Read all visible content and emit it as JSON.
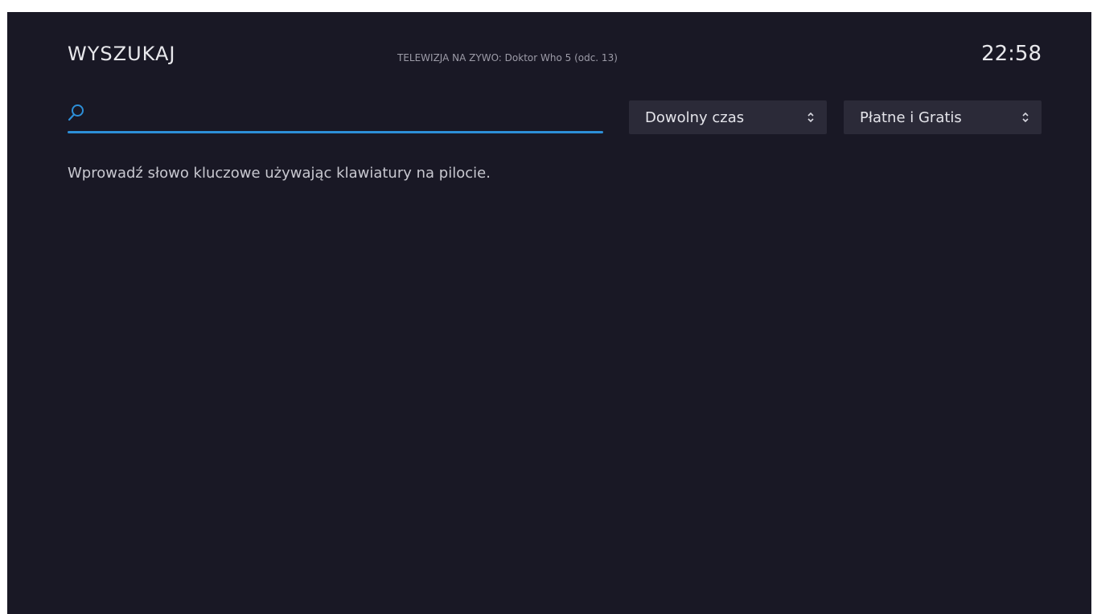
{
  "header": {
    "title": "WYSZUKAJ",
    "now_playing": "TELEWIZJA NA ZYWO: Doktor Who 5 (odc. 13)",
    "clock": "22:58"
  },
  "search": {
    "value": "",
    "placeholder": "",
    "icon": "search-icon",
    "accent_color": "#2d8fd8"
  },
  "filters": {
    "time": {
      "selected": "Dowolny czas",
      "icon": "up-down-arrows-icon"
    },
    "price": {
      "selected": "Płatne i Gratis",
      "icon": "up-down-arrows-icon"
    }
  },
  "hint": "Wprowadź słowo kluczowe używając klawiatury na pilocie.",
  "colors": {
    "background": "#191825",
    "dropdown_background": "#2b2a38",
    "accent": "#2d8fd8"
  }
}
